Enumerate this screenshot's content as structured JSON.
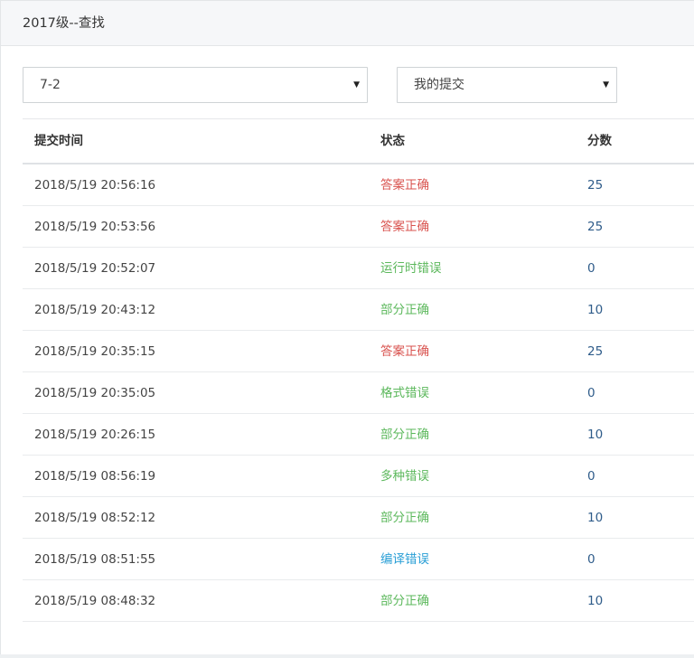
{
  "header": {
    "title": "2017级--查找"
  },
  "filters": {
    "problem_select": {
      "value": "7-2"
    },
    "scope_select": {
      "value": "我的提交"
    }
  },
  "colors": {
    "accepted": "#d9534f",
    "error_green": "#5cb85c",
    "compile_error": "#2a9fd6",
    "score": "#2f5c8a"
  },
  "table": {
    "columns": [
      "提交时间",
      "状态",
      "分数"
    ],
    "rows": [
      {
        "time": "2018/5/19 20:56:16",
        "status": "答案正确",
        "status_type": "accepted",
        "score": "25"
      },
      {
        "time": "2018/5/19 20:53:56",
        "status": "答案正确",
        "status_type": "accepted",
        "score": "25"
      },
      {
        "time": "2018/5/19 20:52:07",
        "status": "运行时错误",
        "status_type": "error_green",
        "score": "0"
      },
      {
        "time": "2018/5/19 20:43:12",
        "status": "部分正确",
        "status_type": "error_green",
        "score": "10"
      },
      {
        "time": "2018/5/19 20:35:15",
        "status": "答案正确",
        "status_type": "accepted",
        "score": "25"
      },
      {
        "time": "2018/5/19 20:35:05",
        "status": "格式错误",
        "status_type": "error_green",
        "score": "0"
      },
      {
        "time": "2018/5/19 20:26:15",
        "status": "部分正确",
        "status_type": "error_green",
        "score": "10"
      },
      {
        "time": "2018/5/19 08:56:19",
        "status": "多种错误",
        "status_type": "error_green",
        "score": "0"
      },
      {
        "time": "2018/5/19 08:52:12",
        "status": "部分正确",
        "status_type": "error_green",
        "score": "10"
      },
      {
        "time": "2018/5/19 08:51:55",
        "status": "编译错误",
        "status_type": "compile_error",
        "score": "0"
      },
      {
        "time": "2018/5/19 08:48:32",
        "status": "部分正确",
        "status_type": "error_green",
        "score": "10"
      }
    ]
  }
}
